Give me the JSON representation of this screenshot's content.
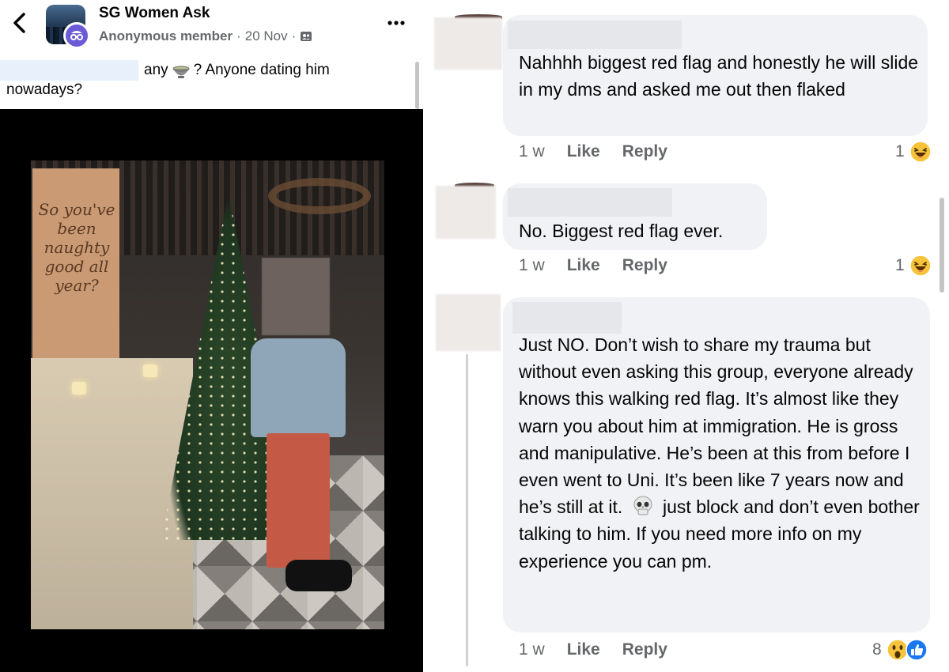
{
  "post": {
    "group_name": "SG Women Ask",
    "author": "Anonymous member",
    "separator": "·",
    "date": "20 Nov",
    "text_part1": "any",
    "text_part2": "? Anyone dating him",
    "text_line2": "nowadays?",
    "banner_text": "So you've been naughty good all year?"
  },
  "icons": {
    "back": "chevron-left-icon",
    "more": "more-horizontal-icon",
    "audience": "group-audience-icon",
    "bowl": "bowl-emoji-icon",
    "anon": "anonymous-badge-icon"
  },
  "comments": [
    {
      "text": "Nahhhh biggest red flag and honestly he will slide in my dms and asked me out then flaked",
      "time": "1 w",
      "like": "Like",
      "reply": "Reply",
      "reaction_count": "1"
    },
    {
      "text": "No. Biggest red flag ever.",
      "time": "1 w",
      "like": "Like",
      "reply": "Reply",
      "reaction_count": "1"
    },
    {
      "text_part1": "Just NO. Don’t wish to share my trauma but without even asking this group, everyone already knows this walking red flag. It’s almost like they warn you about him at immigration. He is gross and manipulative. He’s been at this from before I even went to Uni. It’s been like 7 years now and he’s still at it.",
      "text_part2": "just block and don’t even bother talking to him. If you need more info on my experience you can pm.",
      "time": "1 w",
      "like": "Like",
      "reply": "Reply",
      "reaction_count": "8"
    }
  ],
  "colors": {
    "bubble": "#f0f2f5",
    "secondary_text": "#65676b",
    "anon_badge": "#6b5bd6",
    "like_blue": "#1877f2",
    "emoji_yellow": "#f7c33b"
  }
}
